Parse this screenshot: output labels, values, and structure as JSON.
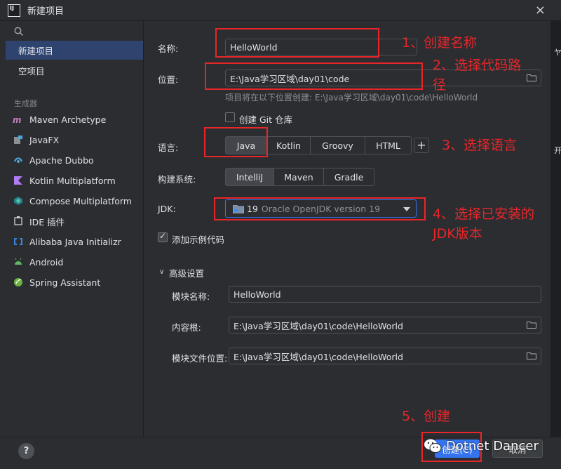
{
  "window": {
    "title": "新建项目",
    "logo_text": "IJ",
    "close_glyph": "×"
  },
  "right_edge_fragments": [
    "ヤ",
    "开"
  ],
  "sidebar": {
    "search_icon": "search-icon",
    "items": [
      {
        "label": "新建项目",
        "selected": true
      },
      {
        "label": "空项目",
        "selected": false
      }
    ],
    "section_label": "生成器",
    "generators": [
      {
        "label": "Maven Archetype",
        "icon": "maven-icon",
        "color": "#c77dbb"
      },
      {
        "label": "JavaFX",
        "icon": "javafx-icon",
        "color": "#8c8f94"
      },
      {
        "label": "Apache Dubbo",
        "icon": "dubbo-icon",
        "color": "#4ea6dc"
      },
      {
        "label": "Kotlin Multiplatform",
        "icon": "kotlin-icon",
        "color": "#b07cf5"
      },
      {
        "label": "Compose Multiplatform",
        "icon": "compose-icon",
        "color": "#4ecfa0"
      },
      {
        "label": "IDE 插件",
        "icon": "plugin-icon",
        "color": "#cfd1d5"
      },
      {
        "label": "Alibaba Java Initializr",
        "icon": "alibaba-icon",
        "color": "#3d8ff5"
      },
      {
        "label": "Android",
        "icon": "android-icon",
        "color": "#5fb85f"
      },
      {
        "label": "Spring Assistant",
        "icon": "spring-icon",
        "color": "#6db33f"
      }
    ]
  },
  "form": {
    "name_label": "名称:",
    "name_value": "HelloWorld",
    "location_label": "位置:",
    "location_value": "E:\\Java学习区域\\day01\\code",
    "location_hint": "项目将在以下位置创建: E:\\Java学习区域\\day01\\code\\HelloWorld",
    "git_checkbox_label": "创建 Git 仓库",
    "git_checked": false,
    "language_label": "语言:",
    "languages": [
      {
        "label": "Java",
        "active": true
      },
      {
        "label": "Kotlin",
        "active": false
      },
      {
        "label": "Groovy",
        "active": false
      },
      {
        "label": "HTML",
        "active": false
      }
    ],
    "add_language_glyph": "+",
    "build_label": "构建系统:",
    "build_systems": [
      {
        "label": "IntelliJ",
        "active": true
      },
      {
        "label": "Maven",
        "active": false
      },
      {
        "label": "Gradle",
        "active": false
      }
    ],
    "jdk_label": "JDK:",
    "jdk_version": "19",
    "jdk_name": "Oracle OpenJDK version 19",
    "sample_code_label": "添加示例代码",
    "sample_code_checked": true,
    "advanced_label": "高级设置",
    "advanced_chevron": "∨",
    "module_name_label": "模块名称:",
    "module_name_value": "HelloWorld",
    "content_root_label": "内容根:",
    "content_root_value": "E:\\Java学习区域\\day01\\code\\HelloWorld",
    "module_file_label": "模块文件位置:",
    "module_file_value": "E:\\Java学习区域\\day01\\code\\HelloWorld"
  },
  "footer": {
    "help_glyph": "?",
    "create_label": "创建(C)",
    "cancel_label": "取消"
  },
  "annotations": {
    "step1": "1、创建名称",
    "step2_line1": "2、选择代码路",
    "step2_line2": "径",
    "step3": "3、选择语言",
    "step4_line1": "4、选择已安装的",
    "step4_line2": "JDK版本",
    "step5": "5、创建",
    "color": "#e8262a"
  },
  "watermark": {
    "text": "Dotnet Dancer",
    "icon": "wechat-icon"
  },
  "colors": {
    "background": "#2b2d30",
    "selection": "#2e436e",
    "accent": "#3574f0",
    "text": "#dfe1e5",
    "muted": "#8c8f94"
  }
}
